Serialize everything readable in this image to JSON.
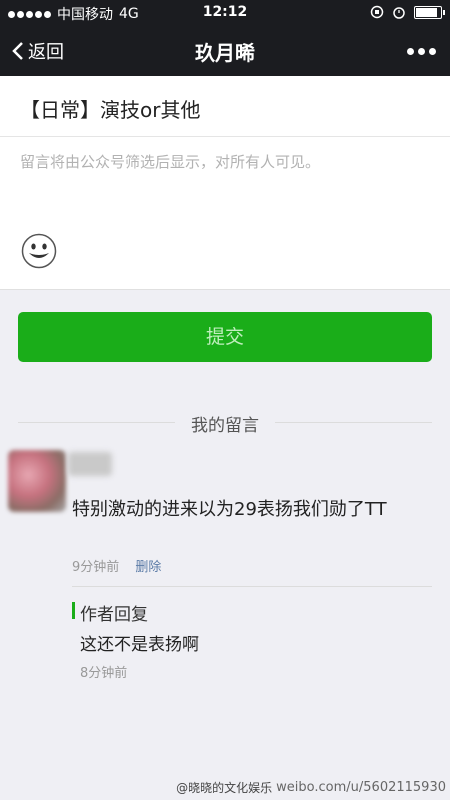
{
  "status_bar": {
    "carrier": "中国移动",
    "network": "4G",
    "time": "12:12"
  },
  "nav": {
    "back_label": "返回",
    "title": "玖月晞"
  },
  "article": {
    "title": "【日常】演技or其他"
  },
  "comment_box": {
    "placeholder": "留言将由公众号筛选后显示，对所有人可见。",
    "emoji_icon": "smiley-icon"
  },
  "submit": {
    "label": "提交"
  },
  "my_comments": {
    "section_label": "我的留言",
    "items": [
      {
        "text": "特别激动的进来以为29表扬我们勋了TT",
        "time": "9分钟前",
        "delete_label": "删除",
        "reply": {
          "label": "作者回复",
          "text": "这还不是表扬啊",
          "time": "8分钟前"
        }
      }
    ]
  },
  "watermark": {
    "handle": "@晓晓的文化娱乐",
    "url": "weibo.com/u/5602115930"
  },
  "colors": {
    "accent_green": "#1aad19",
    "nav_bg": "#1b1c20",
    "link_blue": "#5b7ba6"
  }
}
